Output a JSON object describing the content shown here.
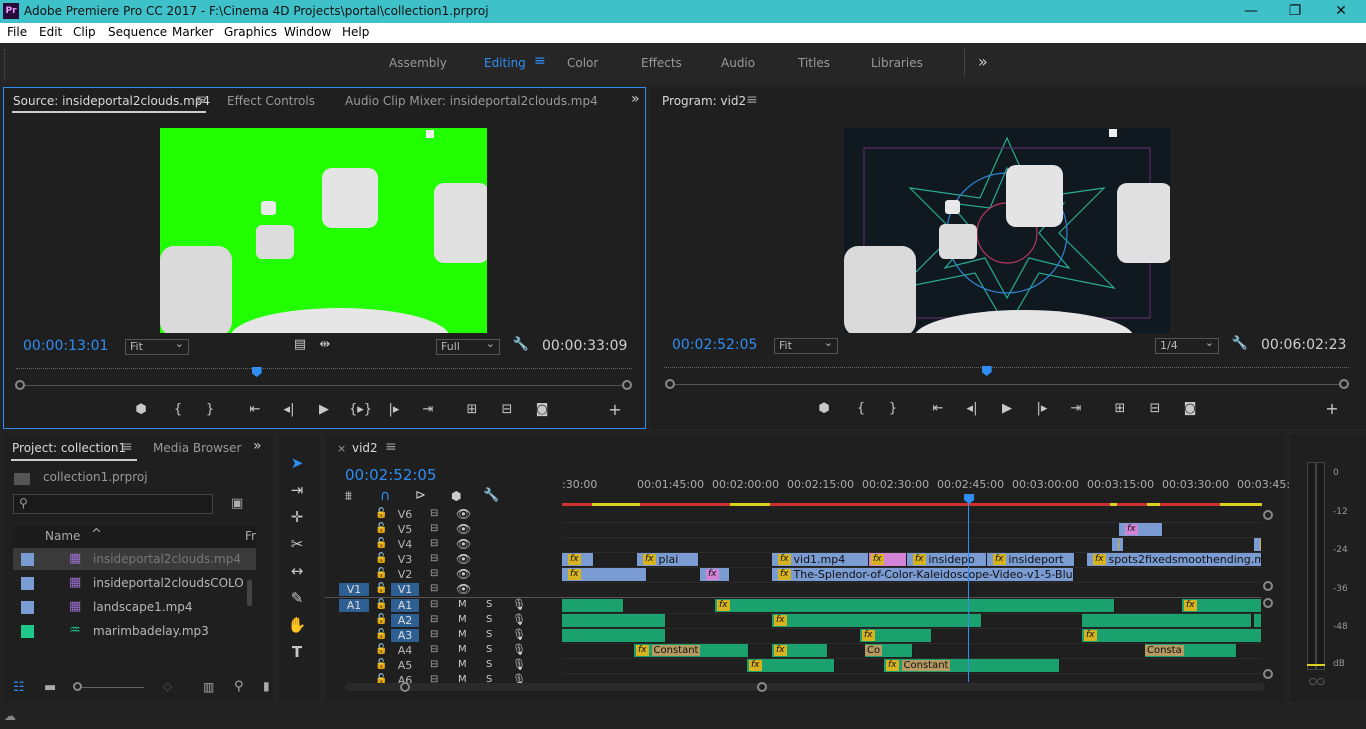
{
  "app": {
    "logo_text": "Pr",
    "title": "Adobe Premiere Pro CC 2017 - F:\\Cinema 4D Projects\\portal\\collection1.prproj",
    "window_buttons": [
      "—",
      "❐",
      "✕"
    ]
  },
  "menu": [
    "File",
    "Edit",
    "Clip",
    "Sequence",
    "Marker",
    "Graphics",
    "Window",
    "Help"
  ],
  "workspaces": {
    "items": [
      "Assembly",
      "Editing",
      "Color",
      "Effects",
      "Audio",
      "Titles",
      "Libraries"
    ],
    "active": "Editing",
    "more": "»"
  },
  "source": {
    "tabs": [
      "Source: insideportal2clouds.mp4",
      "Effect Controls",
      "Audio Clip Mixer: insideportal2clouds.mp4"
    ],
    "timecode": "00:00:13:01",
    "fit": "Fit",
    "resolution": "Full",
    "duration": "00:00:33:09",
    "playhead_fraction": 0.39
  },
  "program": {
    "tab": "Program: vid2",
    "timecode": "00:02:52:05",
    "fit": "Fit",
    "resolution": "1/4",
    "duration": "00:06:02:23",
    "playhead_fraction": 0.47
  },
  "project": {
    "tabs": [
      "Project: collection1",
      "Media Browser"
    ],
    "file": "collection1.prproj",
    "search_placeholder": "",
    "columns": [
      "Name",
      "Fr"
    ],
    "items": [
      {
        "name": "insideportal2clouds.mp4",
        "color": "#7b9bd3",
        "type": "video"
      },
      {
        "name": "insideportal2cloudsCOLO",
        "color": "#7b9bd3",
        "type": "video"
      },
      {
        "name": "landscape1.mp4",
        "color": "#7b9bd3",
        "type": "video"
      },
      {
        "name": "marimbadelay.mp3",
        "color": "#1fc98a",
        "type": "audio"
      }
    ]
  },
  "timeline": {
    "sequence_tab": "vid2",
    "timecode": "00:02:52:05",
    "ruler": [
      ":30:00",
      "00:01:45:00",
      "00:02:00:00",
      "00:02:15:00",
      "00:02:30:00",
      "00:02:45:00",
      "00:03:00:00",
      "00:03:15:00",
      "00:03:30:00",
      "00:03:45:0"
    ],
    "video_tracks": [
      "V6",
      "V5",
      "V4",
      "V3",
      "V2",
      "V1"
    ],
    "audio_tracks": [
      "A1",
      "A2",
      "A3",
      "A4",
      "A5",
      "A6"
    ],
    "source_video": "V1",
    "source_audio": "A1",
    "mute_label": "M",
    "solo_label": "S",
    "clips": {
      "v3_a": "plai",
      "v3_b": "vid1.mp4",
      "v3_c": "insidepo",
      "v3_d": "insideport",
      "v3_e": "spots2fixedsmoothending.m",
      "v2_a": "The-Splendor-of-Color-Kaleidoscope-Video-v1-5-Blu",
      "a4_a": "Constant",
      "a4_b": "Co",
      "a4_c": "Consta",
      "a5_a": "Constant",
      "fx": "fx"
    }
  },
  "meter": {
    "ticks": [
      "0",
      "-12",
      "-24",
      "-36",
      "-48",
      "dB"
    ]
  },
  "colors": {
    "accent": "#2f8df3",
    "titlebar": "#3fc1c9",
    "video_clip": "#7b9bd3",
    "audio_clip": "#1aa16e",
    "fx_badge": "#d7b31f"
  }
}
